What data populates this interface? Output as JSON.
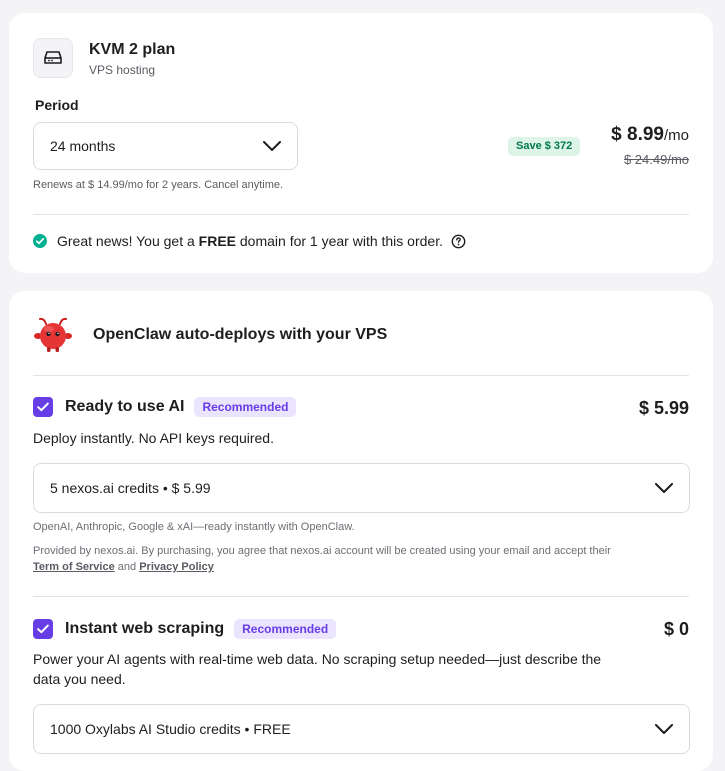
{
  "plan": {
    "title": "KVM 2 plan",
    "subtitle": "VPS hosting",
    "icon": "server-icon",
    "period_label": "Period",
    "period_value": "24 months",
    "renews_text": "Renews at $ 14.99/mo for 2 years. Cancel anytime.",
    "save_badge": "Save $ 372",
    "price": "$ 8.99",
    "price_unit": "/mo",
    "old_price": "$ 24.49/mo",
    "news_prefix": "Great news! You get a ",
    "news_bold": "FREE",
    "news_suffix": " domain for 1 year with this order."
  },
  "openclaw": {
    "title": "OpenClaw auto-deploys with your VPS",
    "mascot": "openclaw-mascot-icon",
    "ai": {
      "title": "Ready to use AI",
      "badge": "Recommended",
      "price": "$ 5.99",
      "description": "Deploy instantly. No API keys required.",
      "select_value": "5 nexos.ai credits • $ 5.99",
      "note": "OpenAI, Anthropic, Google & xAI—ready instantly with OpenClaw.",
      "legal_prefix": "Provided by nexos.ai. By purchasing, you agree that nexos.ai account will be created using your email and accept their",
      "terms_link": "Term of Service",
      "and_text": "and",
      "privacy_link": "Privacy Policy"
    },
    "scraping": {
      "title": "Instant web scraping",
      "badge": "Recommended",
      "price": "$ 0",
      "description_line1": "Power your AI agents with real-time web data. No scraping setup needed—just describe the",
      "description_line2": "data you need.",
      "select_value": "1000 Oxylabs AI Studio credits • FREE"
    }
  },
  "colors": {
    "accent": "#673de6",
    "success": "#00b090",
    "save_badge_bg": "#def4e8",
    "save_badge_text": "#00794a"
  }
}
